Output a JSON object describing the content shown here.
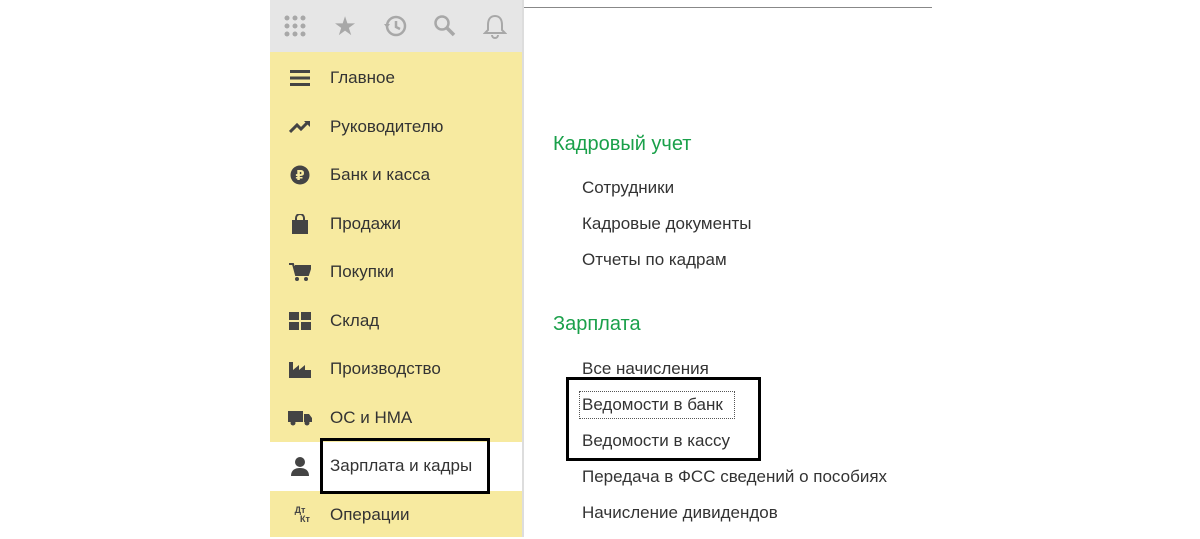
{
  "toolbar": {
    "icons": [
      "apps-grid-icon",
      "star-icon",
      "history-icon",
      "search-icon",
      "bell-icon"
    ]
  },
  "sidebar": {
    "items": [
      {
        "label": "Главное",
        "icon": "menu-icon"
      },
      {
        "label": "Руководителю",
        "icon": "trend-icon"
      },
      {
        "label": "Банк и касса",
        "icon": "ruble-icon"
      },
      {
        "label": "Продажи",
        "icon": "bag-icon"
      },
      {
        "label": "Покупки",
        "icon": "cart-icon"
      },
      {
        "label": "Склад",
        "icon": "warehouse-icon"
      },
      {
        "label": "Производство",
        "icon": "factory-icon"
      },
      {
        "label": "ОС и НМА",
        "icon": "truck-icon"
      },
      {
        "label": "Зарплата и кадры",
        "icon": "person-icon",
        "selected": true
      },
      {
        "label": "Операции",
        "icon": "dt-kt-icon",
        "icon_text": "Дт Кт"
      }
    ]
  },
  "main": {
    "sections": [
      {
        "title": "Кадровый учет",
        "links": [
          "Сотрудники",
          "Кадровые документы",
          "Отчеты по кадрам"
        ]
      },
      {
        "title": "Зарплата",
        "links": [
          "Все начисления",
          "Ведомости в банк",
          "Ведомости в кассу",
          "Передача в ФСС сведений о пособиях",
          "Начисление дивидендов"
        ]
      }
    ]
  },
  "colors": {
    "sidebar": "#f7eaa0",
    "section_title": "#1aa04a",
    "toolbar": "#e6e6e6"
  }
}
